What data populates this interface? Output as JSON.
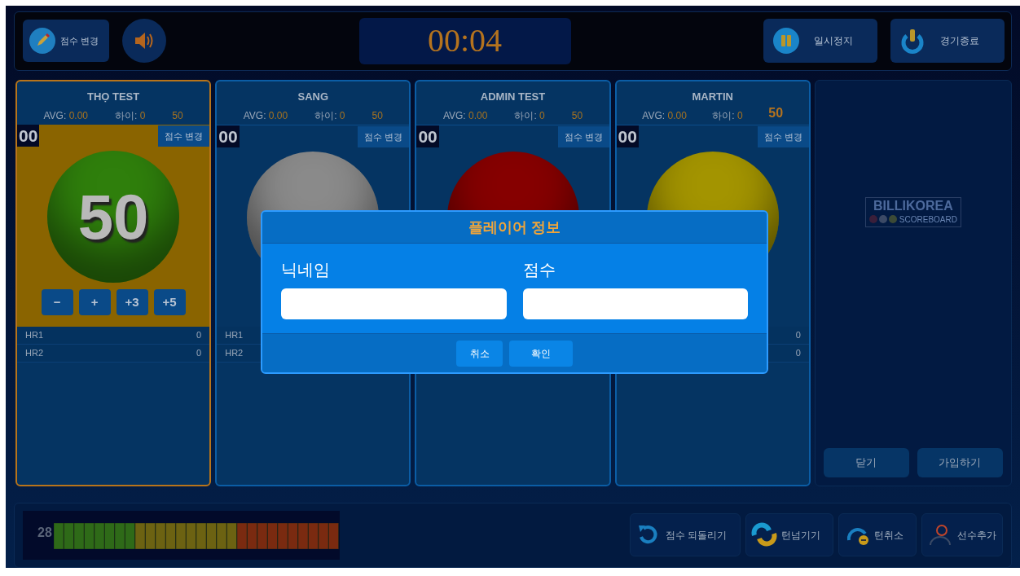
{
  "toolbar": {
    "score_edit_button": "점수 변경",
    "timer": "00:04",
    "pause_button": "일시정지",
    "end_button": "경기종료"
  },
  "players": [
    {
      "name": "THỌ TEST",
      "avg_label": "AVG:",
      "avg": "0.00",
      "high_label": "하이:",
      "high": "0",
      "target": "50",
      "target_bold": false,
      "selected": true,
      "inning": "00",
      "edit_button": "점수 변경",
      "color": "#2f7f0c",
      "ball_score": "50",
      "controls": [
        "−",
        "+",
        "+3",
        "+5"
      ],
      "hr_rows": [
        {
          "label": "HR1",
          "value": "0"
        },
        {
          "label": "HR2",
          "value": "0"
        }
      ]
    },
    {
      "name": "SANG",
      "avg_label": "AVG:",
      "avg": "0.00",
      "high_label": "하이:",
      "high": "0",
      "target": "50",
      "target_bold": false,
      "selected": false,
      "inning": "00",
      "edit_button": "점수 변경",
      "color": "#8a8a8a",
      "hr_rows": [
        {
          "label": "HR1"
        },
        {
          "label": "HR2"
        }
      ]
    },
    {
      "name": "ADMIN TEST",
      "avg_label": "AVG:",
      "avg": "0.00",
      "high_label": "하이:",
      "high": "0",
      "target": "50",
      "target_bold": false,
      "selected": false,
      "inning": "00",
      "edit_button": "점수 변경",
      "color": "#860000"
    },
    {
      "name": "MARTIN",
      "avg_label": "AVG:",
      "avg": "0.00",
      "high_label": "하이:",
      "high": "0",
      "target": "50",
      "target_bold": true,
      "selected": false,
      "inning": "00",
      "edit_button": "점수 변경",
      "color": "#a39400",
      "hr_rows": [
        {
          "value": "0"
        },
        {
          "value": "0"
        }
      ]
    }
  ],
  "side_panel": {
    "logo": "BILLIKOREA",
    "logo_sub": "SCOREBOARD",
    "buttons": [
      "닫기",
      "가입하기"
    ]
  },
  "meter": {
    "count": "28"
  },
  "actions": [
    {
      "kind": "undo",
      "label": "점수 되돌리기"
    },
    {
      "kind": "turn",
      "label": "턴넘기기"
    },
    {
      "kind": "cancel",
      "label": "턴취소"
    },
    {
      "kind": "add",
      "label": "선수추가"
    }
  ],
  "modal": {
    "title": "플레이어 정보",
    "fields": [
      {
        "label": "닉네임"
      },
      {
        "label": "점수"
      }
    ],
    "buttons": [
      "취소",
      "확인"
    ]
  }
}
